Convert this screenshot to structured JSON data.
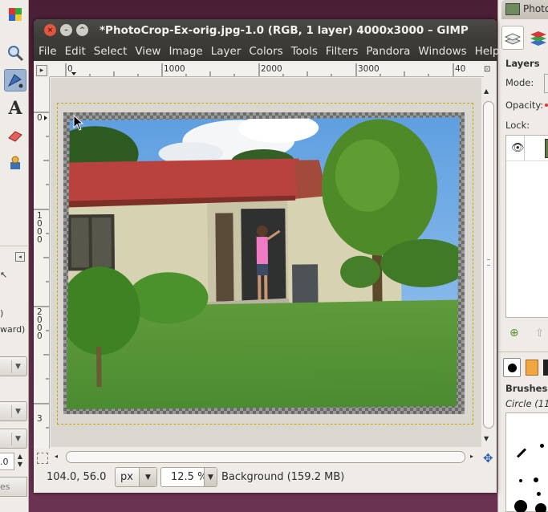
{
  "window": {
    "title": "*PhotoCrop-Ex-orig.jpg-1.0 (RGB, 1 layer) 4000x3000 – GIMP",
    "close_glyph": "×",
    "minimize_glyph": "–",
    "maximize_glyph": "^"
  },
  "menubar": [
    "File",
    "Edit",
    "Select",
    "View",
    "Image",
    "Layer",
    "Colors",
    "Tools",
    "Filters",
    "Pandora",
    "Windows",
    "Help"
  ],
  "ruler_top": {
    "labels": [
      "0",
      "1000",
      "2000",
      "3000",
      "40"
    ]
  },
  "ruler_left": {
    "labels": [
      "0",
      "1000",
      "2000",
      "3"
    ]
  },
  "statusbar": {
    "coordinates": "104.0, 56.0",
    "unit": "px",
    "zoom": "12.5 %",
    "layer_info": "Background (159.2 MB)"
  },
  "toolbox": {
    "tools": [
      {
        "name": "color-tool-icon",
        "glyph": "◧"
      },
      {
        "name": "zoom-tool-icon",
        "glyph": "🔍"
      },
      {
        "name": "paths-tool-icon",
        "glyph": "✒"
      },
      {
        "name": "text-tool-icon",
        "glyph": "A"
      },
      {
        "name": "eraser-tool-icon",
        "glyph": "▰"
      },
      {
        "name": "clone-tool-icon",
        "glyph": "♟"
      }
    ],
    "option_texts": [
      "ward)",
      ")"
    ],
    "option_value": ".0",
    "option_combo_label": "es"
  },
  "dock": {
    "title": "Photo",
    "layers_label": "Layers",
    "mode_label": "Mode:",
    "opacity_label": "Opacity:",
    "lock_label": "Lock:",
    "brushes_label": "Brushes",
    "brush_name": "Circle (11"
  },
  "colors": {
    "titlebar": "#3b3a36",
    "close": "#e2553e",
    "selection": "#c9a600"
  }
}
